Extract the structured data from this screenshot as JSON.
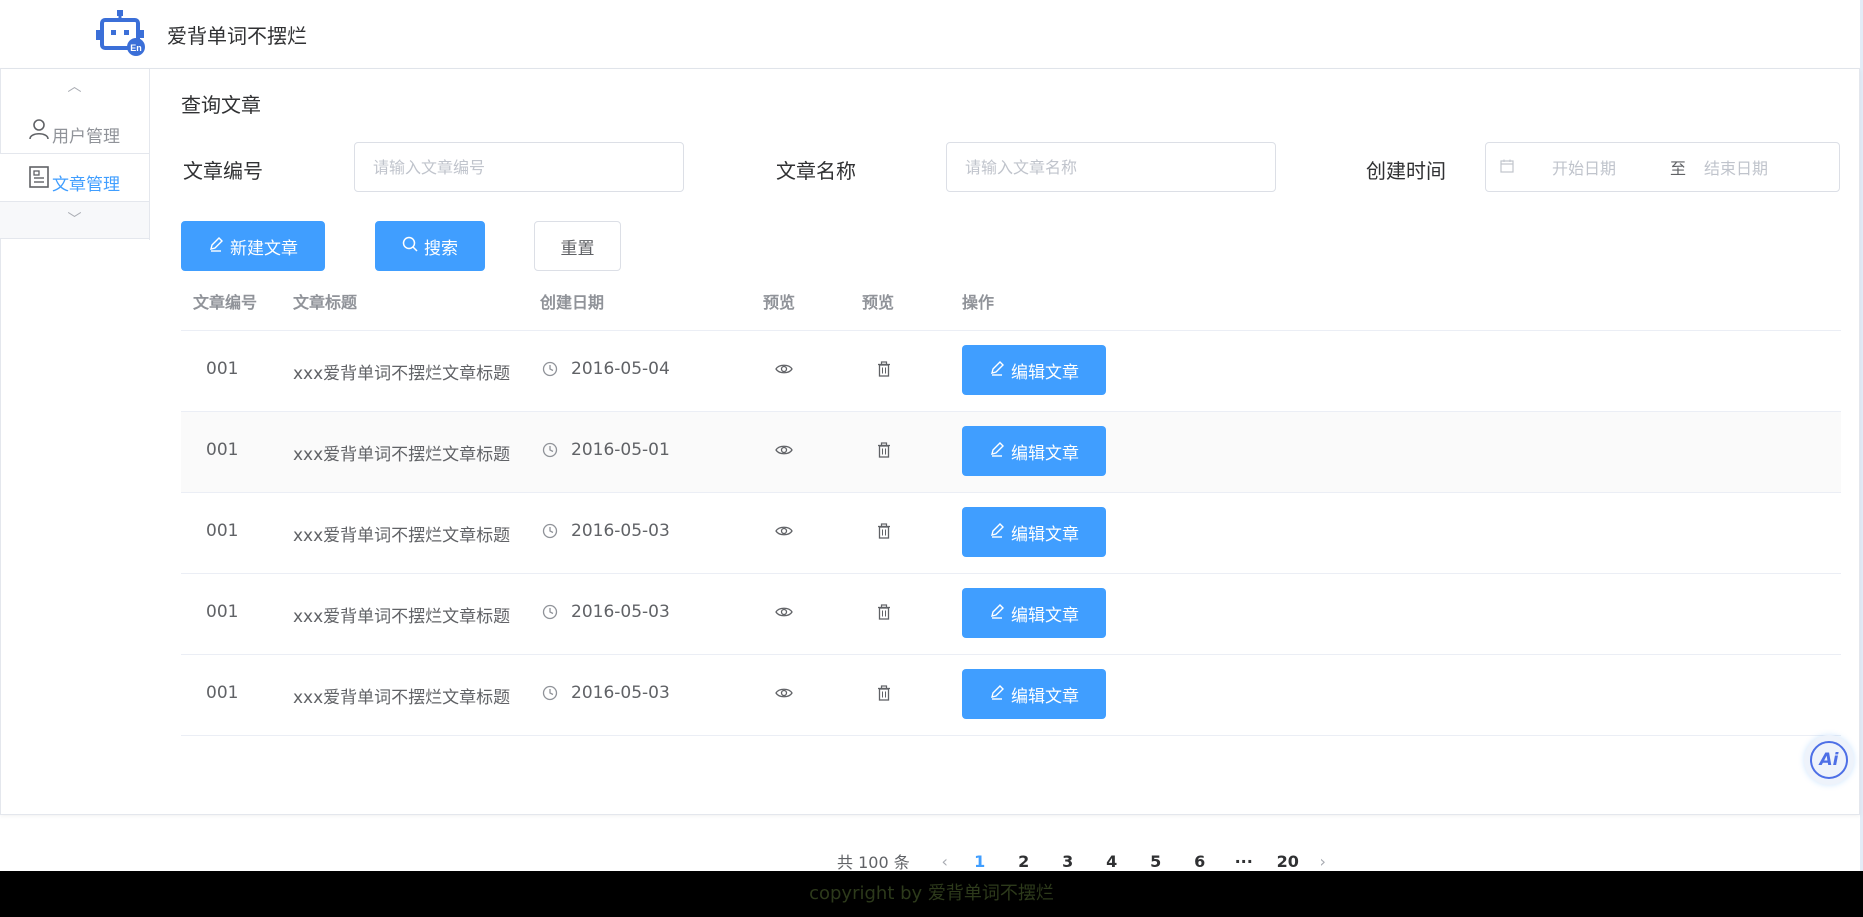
{
  "app": {
    "title": "爱背单词不摆烂"
  },
  "sidebar": {
    "items": [
      {
        "label": "用户管理",
        "icon": "user-icon",
        "active": false
      },
      {
        "label": "文章管理",
        "icon": "document-icon",
        "active": true
      }
    ]
  },
  "query": {
    "section_title": "查询文章",
    "article_id": {
      "label": "文章编号",
      "placeholder": "请输入文章编号",
      "value": ""
    },
    "article_name": {
      "label": "文章名称",
      "placeholder": "请输入文章名称",
      "value": ""
    },
    "created_time": {
      "label": "创建时间",
      "start_placeholder": "开始日期",
      "separator": "至",
      "end_placeholder": "结束日期"
    }
  },
  "toolbar": {
    "new_label": "新建文章",
    "search_label": "搜索",
    "reset_label": "重置"
  },
  "table": {
    "headers": [
      "文章编号",
      "文章标题",
      "创建日期",
      "预览",
      "预览",
      "操作"
    ],
    "rows": [
      {
        "id": "001",
        "title": "xxx爱背单词不摆烂文章标题",
        "date": "2016-05-04",
        "action": "编辑文章"
      },
      {
        "id": "001",
        "title": "xxx爱背单词不摆烂文章标题",
        "date": "2016-05-01",
        "action": "编辑文章"
      },
      {
        "id": "001",
        "title": "xxx爱背单词不摆烂文章标题",
        "date": "2016-05-03",
        "action": "编辑文章"
      },
      {
        "id": "001",
        "title": "xxx爱背单词不摆烂文章标题",
        "date": "2016-05-03",
        "action": "编辑文章"
      },
      {
        "id": "001",
        "title": "xxx爱背单词不摆烂文章标题",
        "date": "2016-05-03",
        "action": "编辑文章"
      }
    ]
  },
  "pagination": {
    "total_text": "共 100 条",
    "pages": [
      "1",
      "2",
      "3",
      "4",
      "5",
      "6",
      "···",
      "20"
    ],
    "current": "1"
  },
  "ai_button": {
    "label": "Ai"
  },
  "footer": {
    "text": "copyright by 爱背单词不摆烂"
  },
  "colors": {
    "primary": "#409eff",
    "footer_bg": "#000000",
    "footer_text": "#2d3a1b"
  }
}
